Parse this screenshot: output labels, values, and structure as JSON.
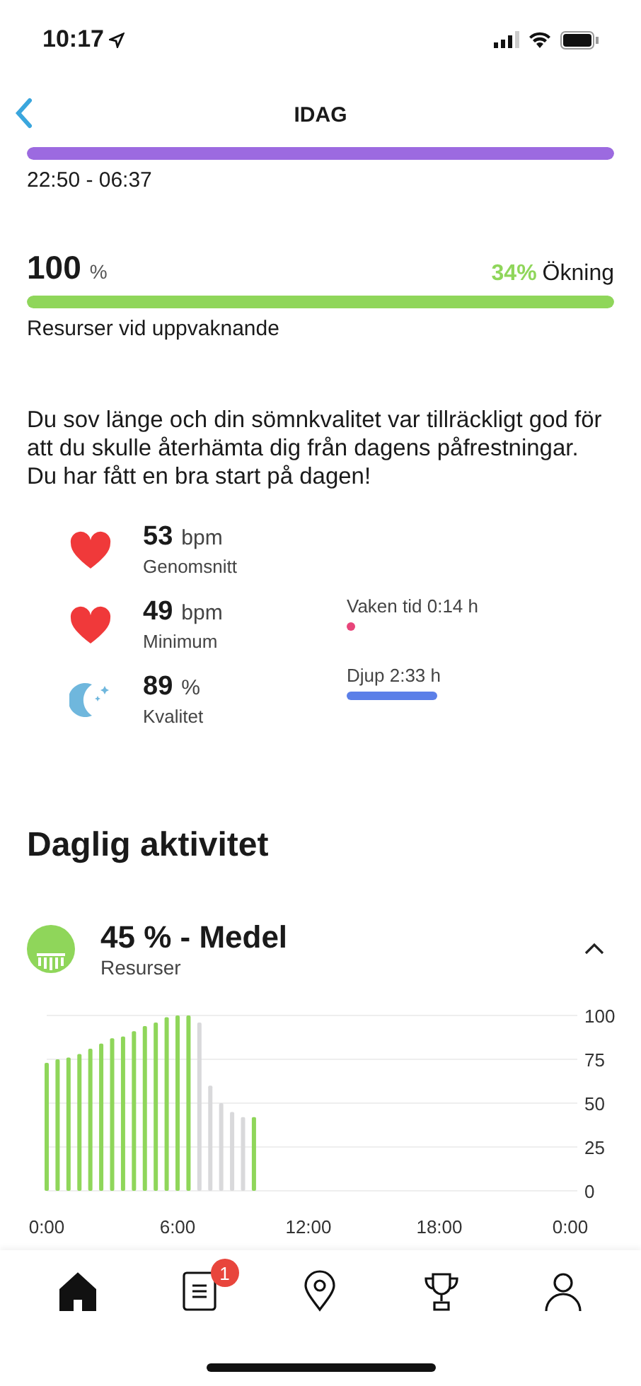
{
  "status_bar": {
    "time": "10:17"
  },
  "nav": {
    "title": "IDAG"
  },
  "sleep_period": {
    "level": 1,
    "range": "22:50 - 06:37"
  },
  "resources": {
    "value": "100",
    "unit": "%",
    "change": "34%",
    "change_label": "Ökning",
    "level": 1,
    "caption": "Resurser vid uppvaknande"
  },
  "summary": "Du sov länge och din sömnkvalitet var tillräckligt god för att du skulle återhämta dig från dagens påfrestningar. Du har fått en bra start på dagen!",
  "stats": [
    {
      "kind": "heart",
      "value": "53",
      "unit": "bpm",
      "label": "Genomsnitt"
    },
    {
      "kind": "heart",
      "value": "49",
      "unit": "bpm",
      "label": "Minimum"
    },
    {
      "kind": "moon",
      "value": "89",
      "unit": "%",
      "label": "Kvalitet"
    }
  ],
  "phases": [
    {
      "kind": "dot",
      "label": "Vaken tid 0:14",
      "unit": "h",
      "color": "#e8457a"
    },
    {
      "kind": "bar",
      "label": "Djup 2:33",
      "unit": "h",
      "color": "#5b7fe8"
    }
  ],
  "section_title": "Daglig aktivitet",
  "activity": {
    "value": "45 % - Medel",
    "label": "Resurser",
    "expanded": true,
    "chart_data": {
      "type": "bar",
      "x": [
        0,
        0.5,
        1,
        1.5,
        2,
        2.5,
        3,
        3.5,
        4,
        4.5,
        5,
        5.5,
        6,
        6.5,
        7,
        7.5,
        8,
        8.5,
        9,
        9.5
      ],
      "series": [
        {
          "color": "#8fd65a",
          "values": [
            73,
            75,
            76,
            78,
            81,
            84,
            87,
            88,
            91,
            94,
            96,
            99,
            100,
            100,
            null,
            null,
            null,
            null,
            null,
            42
          ]
        },
        {
          "color": "#d9d9db",
          "values": [
            null,
            null,
            null,
            null,
            null,
            null,
            null,
            null,
            null,
            null,
            null,
            null,
            null,
            null,
            96,
            60,
            50,
            45,
            42,
            null
          ]
        }
      ],
      "xlim": [
        0,
        24
      ],
      "ylim": [
        0,
        100
      ],
      "xticks": [
        {
          "value": 0,
          "label": "0:00"
        },
        {
          "value": 6,
          "label": "6:00"
        },
        {
          "value": 12,
          "label": "12:00"
        },
        {
          "value": 18,
          "label": "18:00"
        },
        {
          "value": 24,
          "label": "0:00"
        }
      ],
      "yticks": [
        0,
        25,
        50,
        75,
        100
      ],
      "grid": true
    }
  },
  "tabs": [
    {
      "kind": "home",
      "selected": true
    },
    {
      "kind": "diary",
      "selected": false,
      "badge": "1"
    },
    {
      "kind": "map",
      "selected": false
    },
    {
      "kind": "trophy",
      "selected": false
    },
    {
      "kind": "profile",
      "selected": false
    }
  ]
}
